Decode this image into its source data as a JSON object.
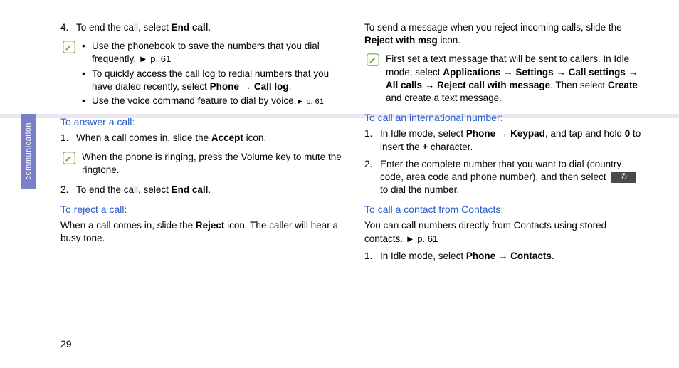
{
  "sideTab": "communication",
  "pageNum": "29",
  "left": {
    "item4": {
      "num": "4.",
      "pre": "To end the call, select ",
      "bold": "End call",
      "post": "."
    },
    "note1": {
      "b1_pre": "Use the phonebook to save the numbers that you dial frequently. ",
      "b1_ref": "► p. 61",
      "b2_pre": "To quickly access the call log to redial numbers that you have dialed recently, select ",
      "b2_bold1": "Phone",
      "b2_arrow": " → ",
      "b2_bold2": "Call log",
      "b2_post": ".",
      "b3_pre": "Use the voice command feature to dial by voice.",
      "b3_ref": "► p. 61"
    },
    "headingAnswer": "To answer a call:",
    "item1a": {
      "num": "1.",
      "pre": "When a call comes in, slide the ",
      "bold": "Accept",
      "post": " icon."
    },
    "note2": "When the phone is ringing, press the Volume key to mute the ringtone.",
    "item2a": {
      "num": "2.",
      "pre": "To end the call, select ",
      "bold": "End call",
      "post": "."
    },
    "headingReject": "To reject a call:",
    "paraReject_pre": "When a call comes in, slide the ",
    "paraReject_bold": "Reject",
    "paraReject_post": " icon. The caller will hear a busy tone."
  },
  "right": {
    "paraTop_pre": "To send a message when you reject incoming calls, slide the ",
    "paraTop_bold": "Reject with msg",
    "paraTop_post": " icon.",
    "note3_pre": "First set a text message that will be sent to callers. In Idle mode, select ",
    "note3_b1": "Applications",
    "note3_a1": " → ",
    "note3_b2": "Settings",
    "note3_a2": " → ",
    "note3_b3": "Call settings",
    "note3_a3": " → ",
    "note3_b4": "All calls",
    "note3_a4": " → ",
    "note3_b5": "Reject call with message",
    "note3_mid": ". Then select ",
    "note3_b6": "Create",
    "note3_post": " and create a text message.",
    "headingIntl": "To call an international number:",
    "i1": {
      "num": "1.",
      "pre": "In Idle mode, select ",
      "b1": "Phone",
      "a1": " → ",
      "b2": "Keypad",
      "mid": ", and tap and hold ",
      "b3": "0",
      "mid2": " to insert the ",
      "b4": "+",
      "post": " character."
    },
    "i2": {
      "num": "2.",
      "pre": "Enter the complete number that you want to dial (country code, area code and phone number), and then select ",
      "post": " to dial the number."
    },
    "headingContacts": "To call a contact from Contacts:",
    "paraContacts_pre": "You can call numbers directly from Contacts using stored contacts. ",
    "paraContacts_ref": "► p. 61",
    "c1": {
      "num": "1.",
      "pre": "In Idle mode, select ",
      "b1": "Phone",
      "a1": " → ",
      "b2": "Contacts",
      "post": "."
    }
  }
}
